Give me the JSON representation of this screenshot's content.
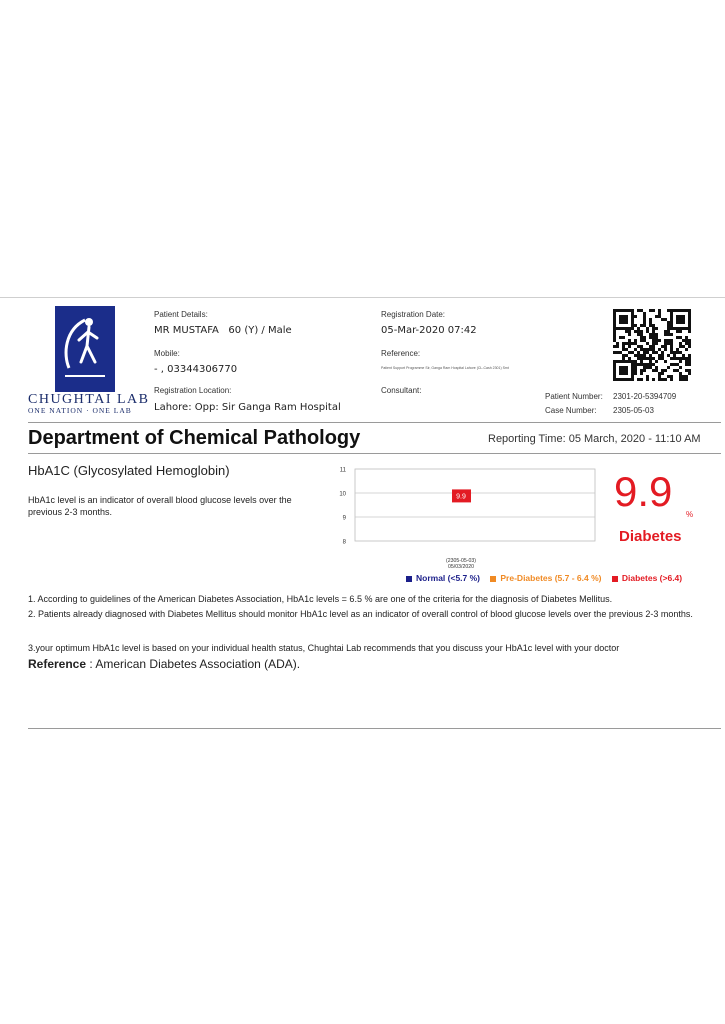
{
  "lab": {
    "brand_name": "CHUGHTAI LAB",
    "brand_tagline": "ONE NATION · ONE LAB",
    "logo_icon": "walking-man-logo"
  },
  "patient": {
    "details_label": "Patient Details:",
    "details_value": "MR MUSTAFA   60 (Y) / Male",
    "mobile_label": "Mobile:",
    "mobile_value": "- , 03344306770",
    "location_label": "Registration Location:",
    "location_value": "Lahore: Opp: Sir Ganga Ram Hospital",
    "registration_date_label": "Registration Date:",
    "registration_date_value": "05-Mar-2020 07:42",
    "reference_label": "Reference:",
    "reference_value": "Patient Support Programme Sir, Ganga Ram Hospital Lahore (CL-Cash 2301) Smt",
    "consultant_label": "Consultant:",
    "patient_number_label": "Patient Number:",
    "patient_number_value": "2301-20-5394709",
    "case_number_label": "Case Number:",
    "case_number_value": "2305-05-03"
  },
  "department": {
    "title": "Department of Chemical Pathology",
    "reporting_time": "Reporting Time: 05 March, 2020 - 11:10 AM"
  },
  "test": {
    "title": "HbA1C (Glycosylated Hemoglobin)",
    "description": "HbA1c level is an indicator of overall blood glucose levels over the previous 2-3 months.",
    "result_value": "9.9",
    "result_unit": "%",
    "result_status": "Diabetes"
  },
  "chart_data": {
    "type": "scatter",
    "x": [
      "(2305-05-03) 05/03/2020"
    ],
    "x_line1": "(2305-05-03)",
    "x_line2": "05/03/2020",
    "values": [
      9.9
    ],
    "data_label": "9.9",
    "ylim": [
      8,
      11
    ],
    "yticks": [
      "11",
      "10",
      "9",
      "8"
    ],
    "grid": true,
    "marker_color": "#e31b23"
  },
  "legend": {
    "normal": "Normal (<5.7 %)",
    "prediabetes": "Pre-Diabetes (5.7 - 6.4 %)",
    "diabetes": "Diabetes (>6.4)",
    "colors": {
      "normal": "#1b1f8a",
      "prediabetes": "#f08a24",
      "diabetes": "#e31b23"
    }
  },
  "notes": {
    "note1": "1. According to guidelines of the American Diabetes Association, HbA1c levels = 6.5 % are one of the criteria for the diagnosis of Diabetes Mellitus.",
    "note2": "2. Patients already diagnosed with Diabetes Mellitus should monitor HbA1c level as an indicator of overall control of blood glucose levels over the previous 2-3 months.",
    "note3": "3.your optimum HbA1c level is based on your individual health status, Chughtai Lab recommends that you discuss your HbA1c level with your doctor",
    "reference_label": "Reference",
    "reference_value": ": American Diabetes Association (ADA)."
  },
  "icons": {
    "qr": "qr-code-icon"
  }
}
